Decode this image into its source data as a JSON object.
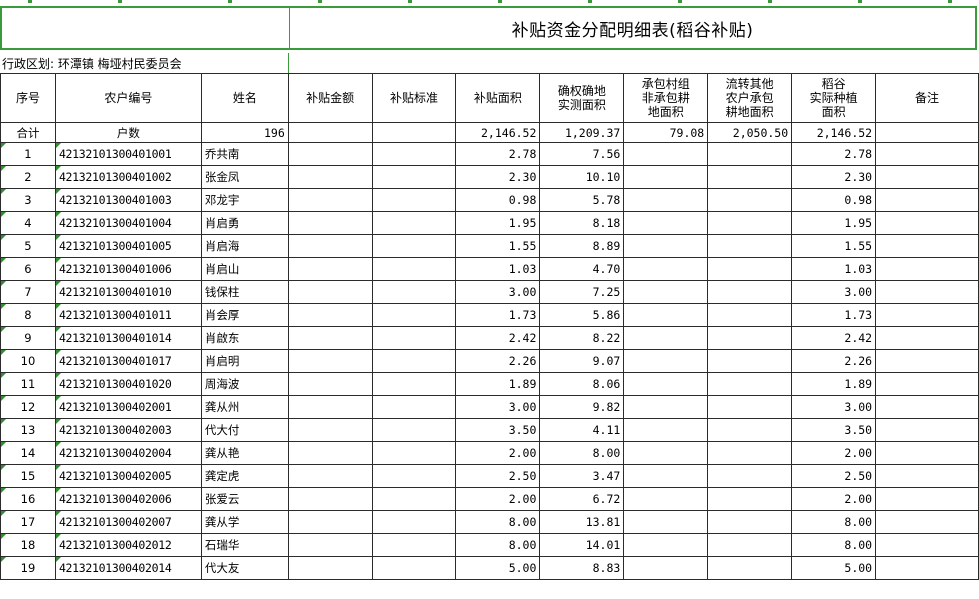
{
  "sheet": {
    "title": "补贴资金分配明细表(稻谷补贴)",
    "region_label": "行政区划: 环潭镇 梅垭村民委员会",
    "headers": [
      "序号",
      "农户编号",
      "姓名",
      "补贴金额",
      "补贴标准",
      "补贴面积",
      "确权确地\n实测面积",
      "承包村组\n非承包耕\n地面积",
      "流转其他\n农户承包\n耕地面积",
      "稻谷\n实际种植\n面积",
      "备注"
    ],
    "summary": {
      "label": "合计",
      "households_label": "户数",
      "households": "196",
      "amount": "",
      "standard": "",
      "area": "2,146.52",
      "measured": "1,209.37",
      "contract": "79.08",
      "transfer": "2,050.50",
      "planted": "2,146.52",
      "note": ""
    },
    "rows": [
      {
        "no": "1",
        "code": "42132101300401001",
        "name": "乔共南",
        "area": "2.78",
        "measured": "7.56",
        "planted": "2.78"
      },
      {
        "no": "2",
        "code": "42132101300401002",
        "name": "张金凤",
        "area": "2.30",
        "measured": "10.10",
        "planted": "2.30"
      },
      {
        "no": "3",
        "code": "42132101300401003",
        "name": "邓龙宇",
        "area": "0.98",
        "measured": "5.78",
        "planted": "0.98"
      },
      {
        "no": "4",
        "code": "42132101300401004",
        "name": "肖启勇",
        "area": "1.95",
        "measured": "8.18",
        "planted": "1.95"
      },
      {
        "no": "5",
        "code": "42132101300401005",
        "name": "肖启海",
        "area": "1.55",
        "measured": "8.89",
        "planted": "1.55"
      },
      {
        "no": "6",
        "code": "42132101300401006",
        "name": "肖启山",
        "area": "1.03",
        "measured": "4.70",
        "planted": "1.03"
      },
      {
        "no": "7",
        "code": "42132101300401010",
        "name": "钱保柱",
        "area": "3.00",
        "measured": "7.25",
        "planted": "3.00"
      },
      {
        "no": "8",
        "code": "42132101300401011",
        "name": "肖会厚",
        "area": "1.73",
        "measured": "5.86",
        "planted": "1.73"
      },
      {
        "no": "9",
        "code": "42132101300401014",
        "name": "肖啟东",
        "area": "2.42",
        "measured": "8.22",
        "planted": "2.42"
      },
      {
        "no": "10",
        "code": "42132101300401017",
        "name": "肖启明",
        "area": "2.26",
        "measured": "9.07",
        "planted": "2.26"
      },
      {
        "no": "11",
        "code": "42132101300401020",
        "name": "周海波",
        "area": "1.89",
        "measured": "8.06",
        "planted": "1.89"
      },
      {
        "no": "12",
        "code": "42132101300402001",
        "name": "龚从州",
        "area": "3.00",
        "measured": "9.82",
        "planted": "3.00"
      },
      {
        "no": "13",
        "code": "42132101300402003",
        "name": "代大付",
        "area": "3.50",
        "measured": "4.11",
        "planted": "3.50"
      },
      {
        "no": "14",
        "code": "42132101300402004",
        "name": "龚从艳",
        "area": "2.00",
        "measured": "8.00",
        "planted": "2.00"
      },
      {
        "no": "15",
        "code": "42132101300402005",
        "name": "龚定虎",
        "area": "2.50",
        "measured": "3.47",
        "planted": "2.50"
      },
      {
        "no": "16",
        "code": "42132101300402006",
        "name": "张爱云",
        "area": "2.00",
        "measured": "6.72",
        "planted": "2.00"
      },
      {
        "no": "17",
        "code": "42132101300402007",
        "name": "龚从学",
        "area": "8.00",
        "measured": "13.81",
        "planted": "8.00"
      },
      {
        "no": "18",
        "code": "42132101300402012",
        "name": "石瑞华",
        "area": "8.00",
        "measured": "14.01",
        "planted": "8.00"
      },
      {
        "no": "19",
        "code": "42132101300402014",
        "name": "代大友",
        "area": "5.00",
        "measured": "8.83",
        "planted": "5.00"
      }
    ]
  },
  "colors": {
    "grid_green": "#3b9a3b",
    "border": "#2b2b2b",
    "cell_marker": "#2f8f2f"
  }
}
